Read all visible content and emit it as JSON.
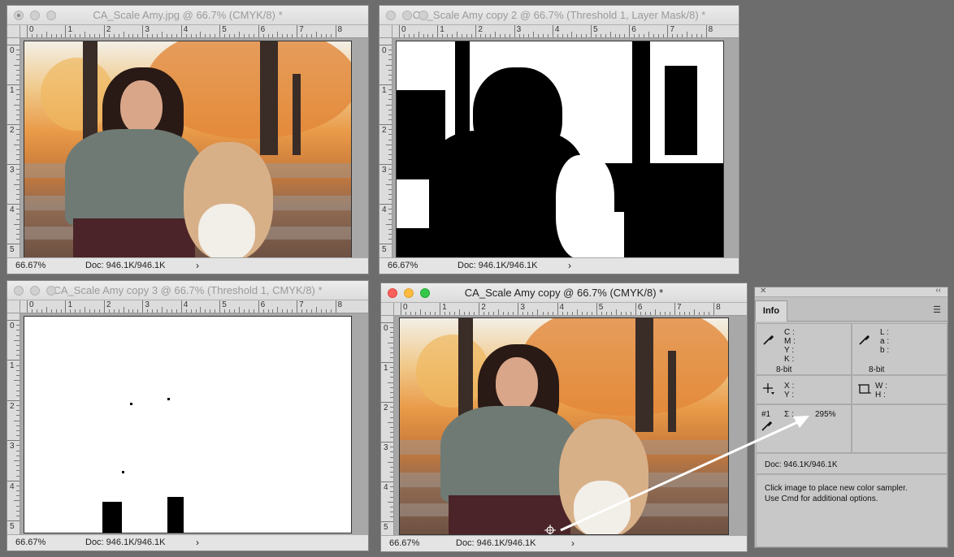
{
  "windows": [
    {
      "title": "CA_Scale Amy.jpg @ 66.7% (CMYK/8) *",
      "zoom": "66.67%",
      "doc": "Doc: 946.1K/946.1K",
      "hruler": [
        "0",
        "1",
        "2",
        "3",
        "4",
        "5",
        "6",
        "7",
        "8"
      ],
      "vruler": [
        "0",
        "1",
        "2",
        "3",
        "4",
        "5"
      ]
    },
    {
      "title": "CA_Scale Amy copy 2 @ 66.7% (Threshold 1, Layer Mask/8) *",
      "zoom": "66.67%",
      "doc": "Doc: 946.1K/946.1K",
      "hruler": [
        "0",
        "1",
        "2",
        "3",
        "4",
        "5",
        "6",
        "7",
        "8"
      ],
      "vruler": [
        "0",
        "1",
        "2",
        "3",
        "4",
        "5"
      ]
    },
    {
      "title": "CA_Scale Amy copy 3 @ 66.7% (Threshold 1, CMYK/8) *",
      "zoom": "66.67%",
      "doc": "Doc: 946.1K/946.1K",
      "hruler": [
        "0",
        "1",
        "2",
        "3",
        "4",
        "5",
        "6",
        "7",
        "8"
      ],
      "vruler": [
        "0",
        "1",
        "2",
        "3",
        "4",
        "5"
      ]
    },
    {
      "title": "CA_Scale Amy copy @ 66.7% (CMYK/8) *",
      "zoom": "66.67%",
      "doc": "Doc: 946.1K/946.1K",
      "hruler": [
        "0",
        "1",
        "2",
        "3",
        "4",
        "5",
        "6",
        "7",
        "8"
      ],
      "vruler": [
        "0",
        "1",
        "2",
        "3",
        "4",
        "5"
      ]
    }
  ],
  "status_arrow": "›",
  "info_panel": {
    "tab": "Info",
    "cmyk_labels": "C :\nM :\nY :\nK :",
    "lab_labels": "L :\na :\nb :",
    "bit_left": "8-bit",
    "bit_right": "8-bit",
    "xy_labels": "X :\nY :",
    "wh_labels": "W :\nH :",
    "sampler_num": "#1",
    "sigma": "Σ :",
    "sampler_value": "295%",
    "doc": "Doc: 946.1K/946.1K",
    "hint": "Click image to place new color sampler.\nUse Cmd for additional options."
  }
}
